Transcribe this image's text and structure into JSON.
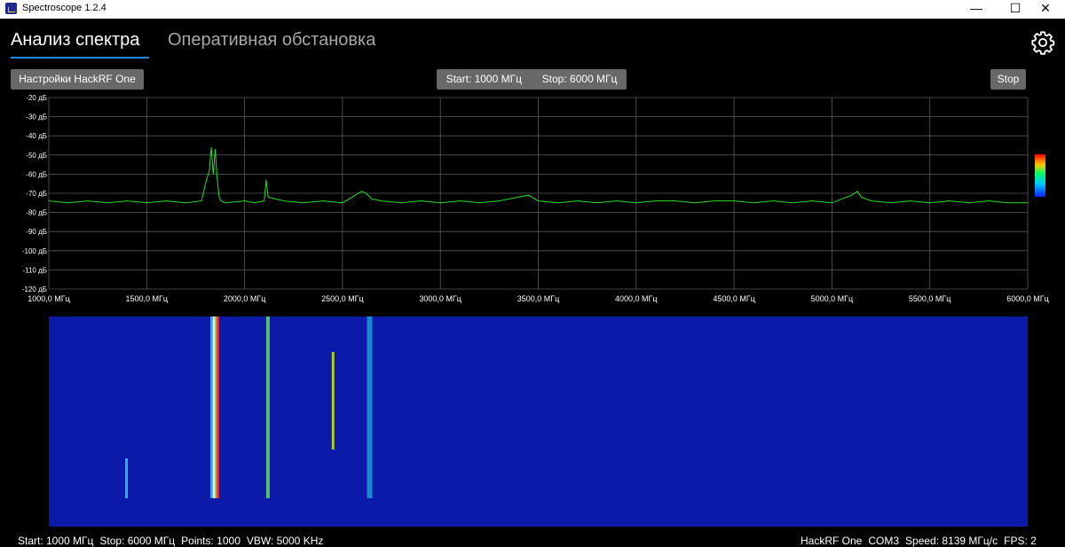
{
  "window": {
    "title": "Spectroscope 1.2.4",
    "controls": [
      "—",
      "☐",
      "✕"
    ]
  },
  "tabs": [
    {
      "label": "Анализ спектра",
      "active": true
    },
    {
      "label": "Оперативная обстановка",
      "active": false
    }
  ],
  "toolbar": {
    "settings_label": "Настройки HackRF One",
    "start_label": "Start: 1000 МГц",
    "stop_range_label": "Stop: 6000 МГц",
    "stop_button_label": "Stop"
  },
  "icons": {
    "settings": "gear-icon",
    "app": "spectrum-app-icon"
  },
  "colors": {
    "trace": "#22e022",
    "waterfall_bg": "#0b1aa8",
    "accent": "#1d8ad6"
  },
  "chart_data": {
    "type": "line",
    "title": "",
    "xlabel": "",
    "ylabel": "",
    "xlim": [
      1000,
      6000
    ],
    "ylim": [
      -120,
      -20
    ],
    "grid": true,
    "y_ticks": [
      "-20 дБ",
      "-30 дБ",
      "-40 дБ",
      "-50 дБ",
      "-60 дБ",
      "-70 дБ",
      "-80 дБ",
      "-90 дБ",
      "-100 дБ",
      "-110 дБ",
      "-120 дБ"
    ],
    "x_ticks": [
      "1000,0 МГц",
      "1500,0 МГц",
      "2000,0 МГц",
      "2500,0 МГц",
      "3000,0 МГц",
      "3500,0 МГц",
      "4000,0 МГц",
      "4500,0 МГц",
      "5000,0 МГц",
      "5500,0 МГц",
      "6000,0 МГц"
    ],
    "series": [
      {
        "x": [
          1000,
          1100,
          1200,
          1300,
          1400,
          1500,
          1600,
          1700,
          1780,
          1800,
          1820,
          1830,
          1840,
          1850,
          1860,
          1870,
          1880,
          1900,
          2000,
          2050,
          2100,
          2110,
          2120,
          2200,
          2300,
          2400,
          2500,
          2550,
          2580,
          2600,
          2620,
          2650,
          2700,
          2800,
          2900,
          3000,
          3100,
          3200,
          3300,
          3400,
          3450,
          3500,
          3600,
          3700,
          3800,
          3900,
          4000,
          4100,
          4200,
          4300,
          4400,
          4500,
          4600,
          4700,
          4800,
          4900,
          5000,
          5100,
          5130,
          5150,
          5200,
          5300,
          5400,
          5500,
          5600,
          5700,
          5800,
          5900,
          6000
        ],
        "y": [
          -74,
          -75,
          -74,
          -75,
          -74,
          -75,
          -74,
          -75,
          -74,
          -65,
          -58,
          -46,
          -60,
          -47,
          -62,
          -72,
          -74,
          -75,
          -74,
          -75,
          -74,
          -63,
          -72,
          -74,
          -75,
          -74,
          -75,
          -72,
          -70,
          -69,
          -70,
          -73,
          -74,
          -75,
          -74,
          -75,
          -74,
          -75,
          -74,
          -72,
          -71,
          -74,
          -75,
          -74,
          -75,
          -74,
          -75,
          -74,
          -74,
          -75,
          -74,
          -74,
          -75,
          -74,
          -75,
          -74,
          -75,
          -71,
          -69,
          -72,
          -74,
          -75,
          -74,
          -75,
          -74,
          -75,
          -74,
          -75,
          -75
        ]
      }
    ]
  },
  "status": {
    "start": "Start: 1000 МГц",
    "stop": "Stop: 6000 МГц",
    "points": "Points: 1000",
    "vbw": "VBW: 5000 KHz",
    "device": "HackRF One",
    "port": "COM3",
    "speed": "Speed: 8139 МГц/с",
    "fps": "FPS: 2"
  }
}
